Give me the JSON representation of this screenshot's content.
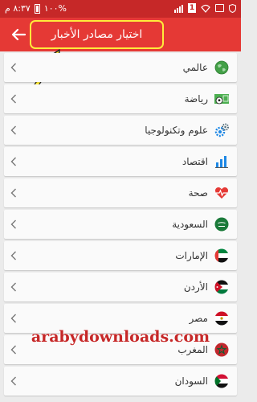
{
  "status_bar": {
    "time": "٨:٣٧ م",
    "battery": "%١٠٠",
    "sim": "1"
  },
  "app_bar": {
    "title": "اختيار مصادر الأخبار"
  },
  "sources": [
    {
      "label": "عالمي",
      "icon": "globe-icon"
    },
    {
      "label": "رياضة",
      "icon": "sports-ball-icon"
    },
    {
      "label": "علوم وتكنولوجيا",
      "icon": "gears-icon"
    },
    {
      "label": "اقتصاد",
      "icon": "bar-chart-icon"
    },
    {
      "label": "صحة",
      "icon": "heart-pulse-icon"
    },
    {
      "label": "السعودية",
      "icon": "saudi-flag-icon"
    },
    {
      "label": "الإمارات",
      "icon": "uae-flag-icon"
    },
    {
      "label": "الأردن",
      "icon": "jordan-flag-icon"
    },
    {
      "label": "مصر",
      "icon": "egypt-flag-icon"
    },
    {
      "label": "المغرب",
      "icon": "morocco-flag-icon"
    },
    {
      "label": "السودان",
      "icon": "sudan-flag-icon"
    }
  ],
  "watermark": "arabydownloads.com",
  "colors": {
    "app_bar": "#e53935",
    "status_bar": "#c62828",
    "highlight": "#ffeb3b"
  }
}
